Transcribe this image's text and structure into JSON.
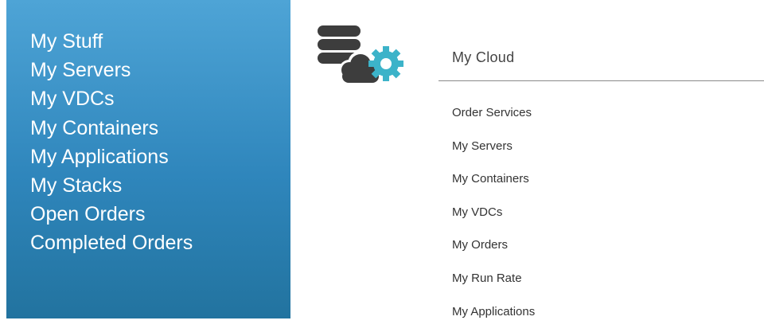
{
  "sidebar": {
    "items": [
      {
        "label": "My Stuff"
      },
      {
        "label": "My Servers"
      },
      {
        "label": "My VDCs"
      },
      {
        "label": "My Containers"
      },
      {
        "label": "My Applications"
      },
      {
        "label": "My Stacks"
      },
      {
        "label": "Open Orders"
      },
      {
        "label": "Completed Orders"
      }
    ]
  },
  "header": {
    "icon": "database-cloud-gear-icon",
    "title": "My Cloud"
  },
  "links": [
    {
      "label": "Order Services"
    },
    {
      "label": "My Servers"
    },
    {
      "label": "My Containers"
    },
    {
      "label": "My VDCs"
    },
    {
      "label": "My Orders"
    },
    {
      "label": "My Run Rate"
    },
    {
      "label": "My Applications"
    }
  ],
  "colors": {
    "sidebar_top": "#4ea4d6",
    "sidebar_bottom": "#22739f",
    "icon_dark": "#3d3d3d",
    "icon_accent": "#3cb3c9"
  }
}
